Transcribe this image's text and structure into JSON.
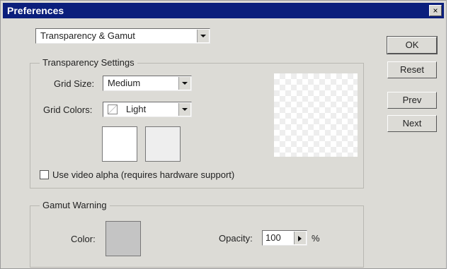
{
  "window": {
    "title": "Preferences",
    "close_glyph": "×"
  },
  "section_select": {
    "value": "Transparency & Gamut"
  },
  "buttons": {
    "ok": "OK",
    "reset": "Reset",
    "prev": "Prev",
    "next": "Next"
  },
  "transparency": {
    "group_label": "Transparency Settings",
    "grid_size_label": "Grid Size:",
    "grid_size_value": "Medium",
    "grid_colors_label": "Grid Colors:",
    "grid_colors_value": "Light",
    "video_alpha_label": "Use video alpha (requires hardware support)",
    "video_alpha_checked": false
  },
  "gamut": {
    "group_label": "Gamut Warning",
    "color_label": "Color:",
    "opacity_label": "Opacity:",
    "opacity_value": "100",
    "opacity_unit": "%"
  },
  "icons": [
    "close-icon",
    "dropdown-arrow-icon",
    "grid-colors-swatch-icon",
    "slider-arrow-icon"
  ],
  "colors": {
    "titlebar": "#0b1f7c",
    "dialog": "#dcdbd6",
    "gamut_swatch": "#c4c4c4"
  }
}
